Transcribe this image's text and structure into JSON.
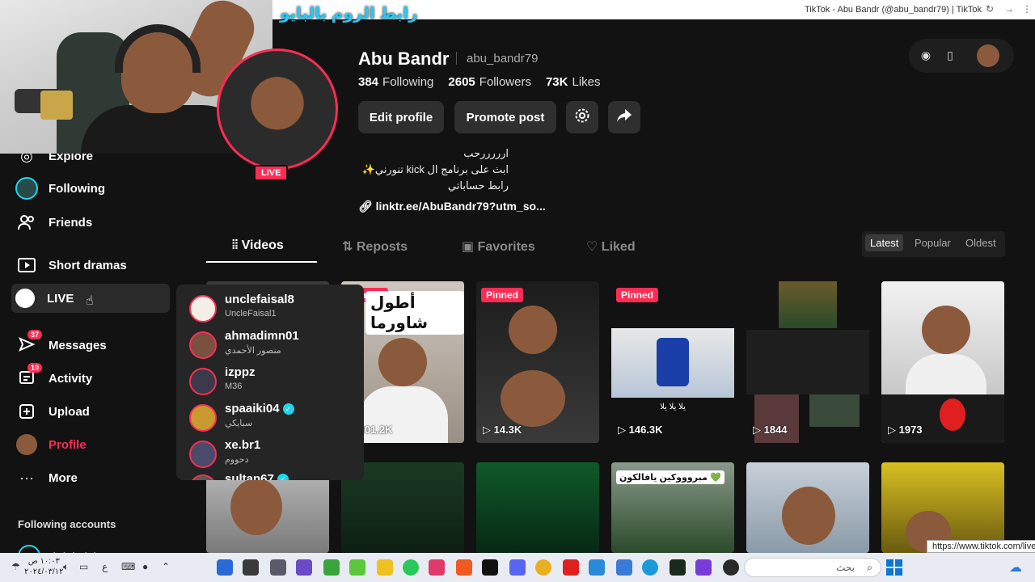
{
  "browser": {
    "title": "TikTok - Abu Bandr (@abu_bandr79) | TikTok"
  },
  "overlay_text": "رابط الروم بالبايو",
  "sidebar": {
    "items": [
      {
        "label": "Explore",
        "icon": "explore-icon"
      },
      {
        "label": "Following",
        "icon": "following-avatar-icon"
      },
      {
        "label": "Friends",
        "icon": "friends-icon"
      },
      {
        "label": "Short dramas",
        "icon": "film-icon"
      },
      {
        "label": "LIVE",
        "icon": "live-circle-icon"
      },
      {
        "label": "Messages",
        "icon": "messages-icon",
        "badge": "37"
      },
      {
        "label": "Activity",
        "icon": "activity-icon",
        "badge": "10"
      },
      {
        "label": "Upload",
        "icon": "upload-icon"
      },
      {
        "label": "Profile",
        "icon": "profile-avatar-icon"
      },
      {
        "label": "More",
        "icon": "more-icon"
      }
    ],
    "following_header": "Following accounts",
    "following_first": "Abdulmlek"
  },
  "profile": {
    "display_name": "Abu Bandr",
    "handle": "abu_bandr79",
    "following_count": "384",
    "following_label": "Following",
    "followers_count": "2605",
    "followers_label": "Followers",
    "likes_count": "73K",
    "likes_label": "Likes",
    "edit_label": "Edit profile",
    "promote_label": "Promote post",
    "live_tag": "LIVE",
    "bio_line1": "ارررررحب",
    "bio_line2": "ابث على برنامج ال kick تنورني✨",
    "bio_line3": "رابط حساباتي",
    "link": "linktr.ee/AbuBandr79?utm_so..."
  },
  "tabs": [
    {
      "label": "Videos",
      "icon": "grid-icon"
    },
    {
      "label": "Reposts",
      "icon": "repost-icon"
    },
    {
      "label": "Favorites",
      "icon": "favorites-icon"
    },
    {
      "label": "Liked",
      "icon": "liked-icon"
    }
  ],
  "sort": [
    "Latest",
    "Popular",
    "Oldest"
  ],
  "videos": [
    {
      "pinned": "",
      "views": ""
    },
    {
      "pinned": "Pinned",
      "views": "301.2K",
      "caption": "أطول شاورما"
    },
    {
      "pinned": "Pinned",
      "views": "14.3K"
    },
    {
      "pinned": "Pinned",
      "views": "146.3K",
      "caption": "يلا يلا يلا"
    },
    {
      "pinned": "",
      "views": "1844"
    },
    {
      "pinned": "",
      "views": "1973"
    },
    {
      "caption": "مبروووكين يافالكون 💚"
    }
  ],
  "live_popup": [
    {
      "name": "unclefaisal8",
      "sub": "UncleFaisal1",
      "verified": false
    },
    {
      "name": "ahmadimn01",
      "sub": "منصور الأحمدي",
      "verified": false
    },
    {
      "name": "izppz",
      "sub": "M36",
      "verified": false
    },
    {
      "name": "spaaiki04",
      "sub": "سبايكي",
      "verified": true
    },
    {
      "name": "xe.br1",
      "sub": "دحووم",
      "verified": false
    },
    {
      "name": "sultan67",
      "sub": "",
      "verified": true
    }
  ],
  "status_url": "https://www.tiktok.com/live",
  "taskbar": {
    "time": "١٠:٠٣ ص",
    "date": "٢٠٢٤/٠٣/١٢",
    "lang": "ع",
    "search_placeholder": "بحث"
  },
  "colors": {
    "accent": "#fe2c55",
    "background": "#121212",
    "verified": "#20d5ec"
  }
}
